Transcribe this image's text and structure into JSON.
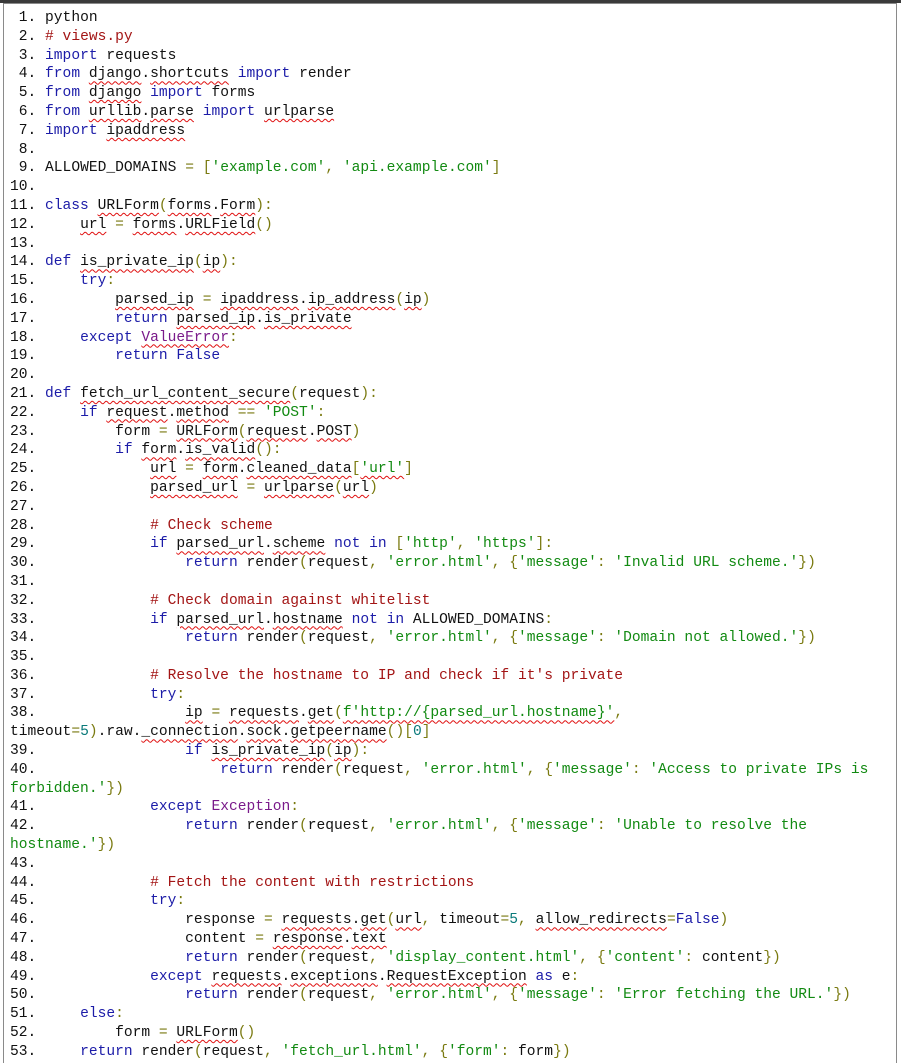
{
  "editor": {
    "lines": [
      "python",
      "# views.py",
      "import requests",
      "from django.shortcuts import render",
      "from django import forms",
      "from urllib.parse import urlparse",
      "import ipaddress",
      "",
      "ALLOWED_DOMAINS = ['example.com', 'api.example.com']",
      "",
      "class URLForm(forms.Form):",
      "    url = forms.URLField()",
      "",
      "def is_private_ip(ip):",
      "    try:",
      "        parsed_ip = ipaddress.ip_address(ip)",
      "        return parsed_ip.is_private",
      "    except ValueError:",
      "        return False",
      "",
      "def fetch_url_content_secure(request):",
      "    if request.method == 'POST':",
      "        form = URLForm(request.POST)",
      "        if form.is_valid():",
      "            url = form.cleaned_data['url']",
      "            parsed_url = urlparse(url)",
      "",
      "            # Check scheme",
      "            if parsed_url.scheme not in ['http', 'https']:",
      "                return render(request, 'error.html', {'message': 'Invalid URL scheme.'})",
      "",
      "            # Check domain against whitelist",
      "            if parsed_url.hostname not in ALLOWED_DOMAINS:",
      "                return render(request, 'error.html', {'message': 'Domain not allowed.'})",
      "",
      "            # Resolve the hostname to IP and check if it's private",
      "            try:",
      "                ip = requests.get(f'http://{parsed_url.hostname}', timeout=5).raw._connection.sock.getpeername()[0]",
      "                if is_private_ip(ip):",
      "                    return render(request, 'error.html', {'message': 'Access to private IPs is forbidden.'})",
      "            except Exception:",
      "                return render(request, 'error.html', {'message': 'Unable to resolve the hostname.'})",
      "",
      "            # Fetch the content with restrictions",
      "            try:",
      "                response = requests.get(url, timeout=5, allow_redirects=False)",
      "                content = response.text",
      "                return render(request, 'display_content.html', {'content': content})",
      "            except requests.exceptions.RequestException as e:",
      "                return render(request, 'error.html', {'message': 'Error fetching the URL.'})",
      "    else:",
      "        form = URLForm()",
      "    return render(request, 'fetch_url.html', {'form': form})"
    ],
    "misspelled": {
      "4": [
        "django",
        "shortcuts"
      ],
      "5": [
        "django"
      ],
      "6": [
        "urllib",
        "parse",
        "urlparse"
      ],
      "7": [
        "ipaddress"
      ],
      "11": [
        "URLForm",
        "forms",
        "Form"
      ],
      "12": [
        "url",
        "forms",
        "URLField"
      ],
      "14": [
        "is_private_ip",
        "ip"
      ],
      "16": [
        "parsed_ip",
        "ipaddress",
        "ip_address",
        "ip"
      ],
      "17": [
        "parsed_ip",
        "is_private"
      ],
      "18": [
        "ValueError"
      ],
      "21": [
        "fetch_url_content_secure"
      ],
      "22": [
        "request",
        "method"
      ],
      "23": [
        "URLForm",
        "request",
        "POST"
      ],
      "24": [
        "form",
        "is_valid"
      ],
      "25": [
        "url",
        "form",
        "cleaned_data",
        "'url'"
      ],
      "26": [
        "parsed_url",
        "urlparse",
        "url"
      ],
      "29": [
        "parsed_url",
        "scheme"
      ],
      "33": [
        "parsed_url",
        "hostname"
      ],
      "38": [
        "ip",
        "requests",
        "get",
        "f'http://{parsed_url.hostname}'",
        "_connection",
        "sock",
        "getpeername"
      ],
      "39": [
        "is_private_ip",
        "ip"
      ],
      "46": [
        "requests",
        "get",
        "url",
        "allow_redirects"
      ],
      "47": [
        "response",
        "text"
      ],
      "49": [
        "requests",
        "exceptions",
        "RequestException"
      ],
      "52": [
        "URLForm"
      ]
    }
  }
}
